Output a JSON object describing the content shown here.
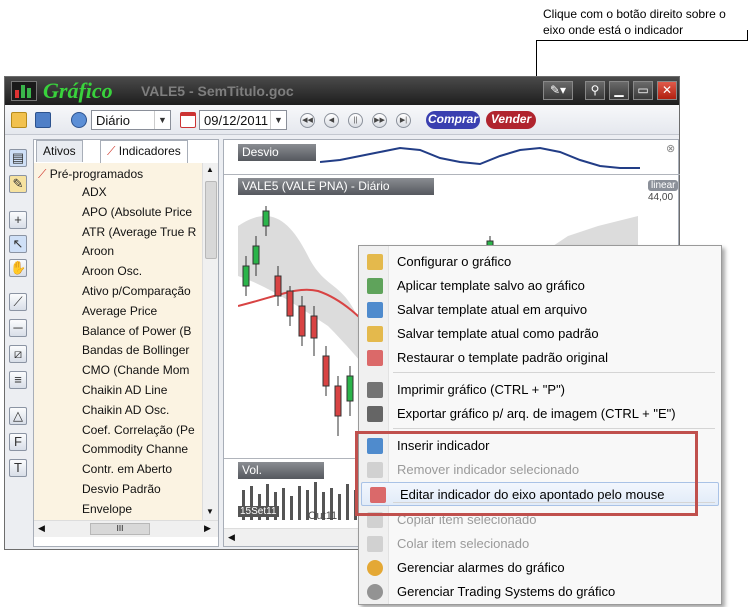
{
  "callout": {
    "line1": "Clique com o botão direito sobre o",
    "line2": "eixo onde está o indicador"
  },
  "window": {
    "app_title": "Gráfico",
    "doc_title": "VALE5 - SemTitulo.goc"
  },
  "toolbar": {
    "period": "Diário",
    "date": "09/12/2011",
    "buy_label": "Comprar",
    "sell_label": "Vender",
    "buy_color": "#3a3fb0",
    "sell_color": "#b0242e"
  },
  "panel": {
    "tabs": [
      {
        "label": "Ativos"
      },
      {
        "label": "Indicadores"
      }
    ],
    "section": "Pré-programados",
    "items": [
      "ADX",
      "APO (Absolute Price",
      "ATR (Average True R",
      "Aroon",
      "Aroon Osc.",
      "Ativo p/Comparação",
      "Average Price",
      "Balance of Power (B",
      "Bandas de Bollinger",
      "CMO (Chande Mom",
      "Chaikin AD Line",
      "Chaikin AD Osc.",
      "Coef. Correlação (Pe",
      "Commodity Channe",
      "Contr. em Aberto",
      "Desvio Padrão",
      "Envelope"
    ],
    "hscroll_grip": "III"
  },
  "chart": {
    "top_label": "Desvio Padrão",
    "main_label": "VALE5 (VALE        PNA) - Diário",
    "scale_badge": "linear",
    "price_tick": "44,00",
    "volume_label": "Vol. Negociado",
    "date_start": "15Set11",
    "date_tick": "Out11"
  },
  "menu": {
    "items": [
      {
        "label": "Configurar o gráfico",
        "icon": "chart-config-icon",
        "disabled": false
      },
      {
        "label": "Aplicar template salvo ao gráfico",
        "icon": "apply-template-icon",
        "disabled": false
      },
      {
        "label": "Salvar template atual em arquivo",
        "icon": "save-template-icon",
        "disabled": false
      },
      {
        "label": "Salvar template atual como padrão",
        "icon": "default-template-icon",
        "disabled": false
      },
      {
        "label": "Restaurar o template padrão original",
        "icon": "restore-template-icon",
        "disabled": false
      },
      {
        "label": "Imprimir gráfico  (CTRL + \"P\")",
        "icon": "print-icon",
        "disabled": false
      },
      {
        "label": "Exportar gráfico p/ arq. de imagem  (CTRL + \"E\")",
        "icon": "camera-icon",
        "disabled": false
      },
      {
        "label": "Inserir indicador",
        "icon": "insert-indicator-icon",
        "disabled": false
      },
      {
        "label": "Remover indicador selecionado",
        "icon": "remove-indicator-icon",
        "disabled": true
      },
      {
        "label": "Editar indicador do eixo apontado pelo mouse",
        "icon": "edit-indicator-icon",
        "disabled": false
      },
      {
        "label": "Copiar item selecionado",
        "icon": "copy-icon",
        "disabled": true
      },
      {
        "label": "Colar item selecionado",
        "icon": "paste-icon",
        "disabled": true
      },
      {
        "label": "Gerenciar alarmes do gráfico",
        "icon": "alarm-bell-icon",
        "disabled": false
      },
      {
        "label": "Gerenciar Trading Systems do gráfico",
        "icon": "gear-icon",
        "disabled": false
      }
    ]
  }
}
